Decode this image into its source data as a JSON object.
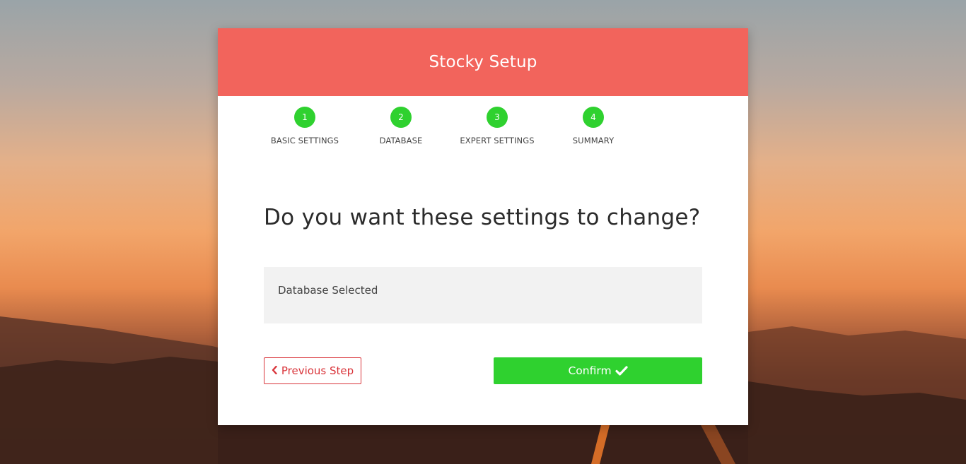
{
  "app": {
    "title": "Stocky Setup"
  },
  "steps": [
    {
      "number": "1",
      "label": "BASIC SETTINGS"
    },
    {
      "number": "2",
      "label": "DATABASE"
    },
    {
      "number": "3",
      "label": "EXPERT SETTINGS"
    },
    {
      "number": "4",
      "label": "SUMMARY"
    }
  ],
  "main": {
    "question": "Do you want these settings to change?",
    "summary_text": "Database Selected"
  },
  "actions": {
    "previous_label": "Previous Step",
    "previous_icon": "chevron-left-icon",
    "confirm_label": "Confirm",
    "confirm_icon": "check-icon"
  },
  "colors": {
    "header": "#f2645c",
    "step_complete": "#2fd12f",
    "confirm": "#2fd12f",
    "previous_outline": "#d9343a"
  }
}
